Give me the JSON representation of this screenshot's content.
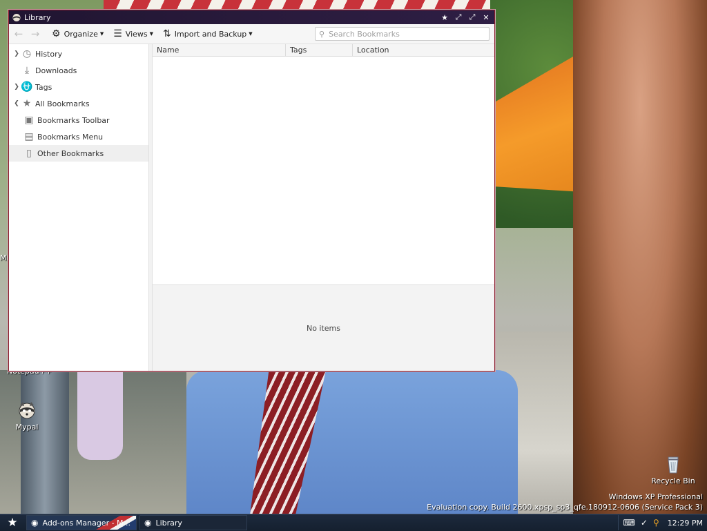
{
  "window": {
    "title": "Library",
    "controls": {
      "pin": "★",
      "minimize": "⤢",
      "maximize": "⤢",
      "close": "✕"
    }
  },
  "toolbar": {
    "back_icon": "back-arrow-icon",
    "forward_icon": "forward-arrow-icon",
    "organize_label": "Organize",
    "views_label": "Views",
    "import_backup_label": "Import and Backup",
    "search_placeholder": "Search Bookmarks"
  },
  "sidebar": {
    "items": [
      {
        "label": "History",
        "icon": "clock-icon",
        "expandable": true
      },
      {
        "label": "Downloads",
        "icon": "download-icon",
        "expandable": false
      },
      {
        "label": "Tags",
        "icon": "tag-icon",
        "expandable": true
      },
      {
        "label": "All Bookmarks",
        "icon": "star-icon",
        "expanded": true
      },
      {
        "label": "Bookmarks Toolbar",
        "icon": "toolbar-icon"
      },
      {
        "label": "Bookmarks Menu",
        "icon": "menu-icon"
      },
      {
        "label": "Other Bookmarks",
        "icon": "folder-icon",
        "selected": true
      }
    ]
  },
  "table": {
    "columns": [
      "Name",
      "Tags",
      "Location"
    ],
    "rows": []
  },
  "details": {
    "empty_text": "No items"
  },
  "desktop": {
    "icons": [
      {
        "label": "Mypal",
        "icon": "raccoon-icon"
      },
      {
        "label": "Recycle Bin",
        "icon": "recycle-bin-icon"
      }
    ],
    "clipped_labels": {
      "notepad": "Notepad++",
      "mi": "Mi\nS"
    },
    "watermark": {
      "line1": "Windows XP Professional",
      "line2": "Evaluation copy. Build 2600.xpsp_sp3_qfe.180912-0606 (Service Pack 3)"
    }
  },
  "taskbar": {
    "start_icon": "star-start-icon",
    "tasks": [
      {
        "label": "Add-ons Manager - M...",
        "icon": "raccoon-icon"
      },
      {
        "label": "Library",
        "icon": "raccoon-icon"
      }
    ],
    "tray_icons": [
      "keyboard-icon",
      "network-icon",
      "search-icon"
    ],
    "clock": "12:29 PM"
  },
  "colors": {
    "titlebar": "#2a1b3d",
    "window_border": "#8b1a2b",
    "taskbar": "#1d2a3d",
    "selection": "#efefef"
  }
}
